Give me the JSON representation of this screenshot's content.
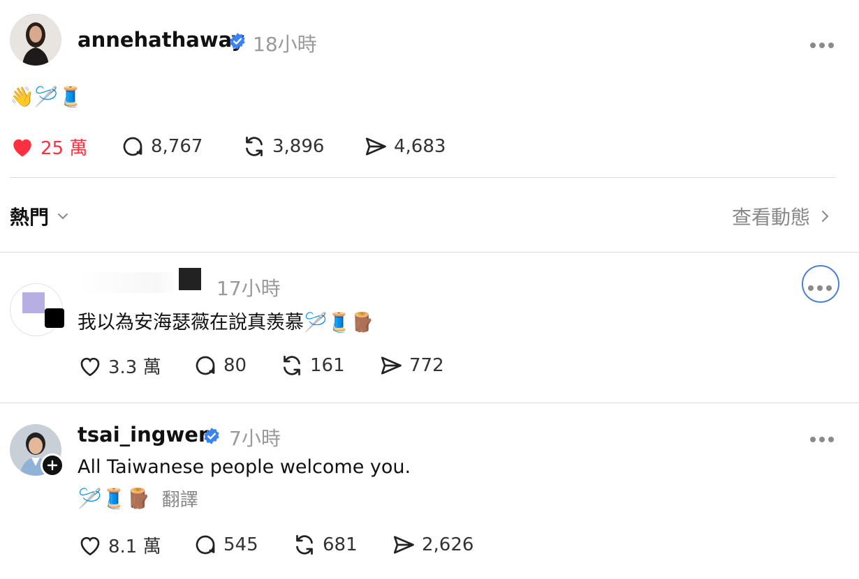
{
  "post": {
    "username": "annehathaway",
    "time": "18小時",
    "content": "👋🪡🧵",
    "likes": "25 萬",
    "comments": "8,767",
    "reposts": "3,896",
    "shares": "4,683"
  },
  "sort_bar": {
    "label": "熱門",
    "view_activity": "查看動態"
  },
  "replies": [
    {
      "username": "",
      "time": "17小時",
      "content": "我以為安海瑟薇在說真羨慕🪡🧵🪵",
      "likes": "3.3 萬",
      "comments": "80",
      "reposts": "161",
      "shares": "772"
    },
    {
      "username": "tsai_ingwen",
      "time": "7小時",
      "content": "All Taiwanese people welcome you.",
      "emoji_line": "🪡🧵🪵",
      "translate": "翻譯",
      "likes": "8.1 萬",
      "comments": "545",
      "reposts": "681",
      "shares": "2,626"
    }
  ],
  "colors": {
    "like_active": "#ff3040",
    "verified": "#3b82f6",
    "focus_ring": "#4a7fd4"
  }
}
